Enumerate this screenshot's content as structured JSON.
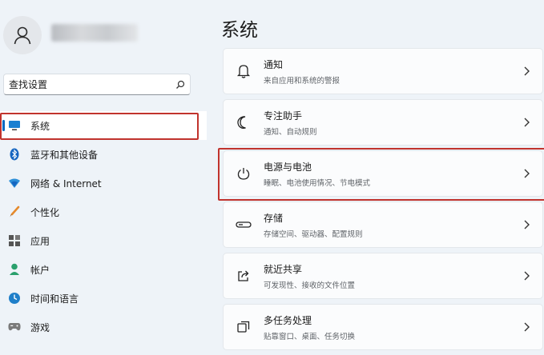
{
  "sidebar": {
    "search_placeholder": "查找设置",
    "items": [
      {
        "label": "系统",
        "icon": "monitor-icon"
      },
      {
        "label": "蓝牙和其他设备",
        "icon": "bluetooth-icon"
      },
      {
        "label": "网络 & Internet",
        "icon": "wifi-icon"
      },
      {
        "label": "个性化",
        "icon": "brush-icon"
      },
      {
        "label": "应用",
        "icon": "apps-icon"
      },
      {
        "label": "帐户",
        "icon": "person-icon"
      },
      {
        "label": "时间和语言",
        "icon": "globe-clock-icon"
      },
      {
        "label": "游戏",
        "icon": "gamepad-icon"
      }
    ]
  },
  "main": {
    "title": "系统",
    "cards": [
      {
        "title": "通知",
        "subtitle": "来自应用和系统的警报",
        "icon": "bell-icon"
      },
      {
        "title": "专注助手",
        "subtitle": "通知、自动规则",
        "icon": "moon-icon"
      },
      {
        "title": "电源与电池",
        "subtitle": "睡眠、电池使用情况、节电模式",
        "icon": "power-icon"
      },
      {
        "title": "存储",
        "subtitle": "存储空间、驱动器、配置规则",
        "icon": "storage-icon"
      },
      {
        "title": "就近共享",
        "subtitle": "可发现性、接收的文件位置",
        "icon": "share-icon"
      },
      {
        "title": "多任务处理",
        "subtitle": "贴靠窗口、桌面、任务切换",
        "icon": "multitask-icon"
      }
    ]
  },
  "colors": {
    "accent": "#0067c0",
    "highlight": "#c1332d"
  }
}
